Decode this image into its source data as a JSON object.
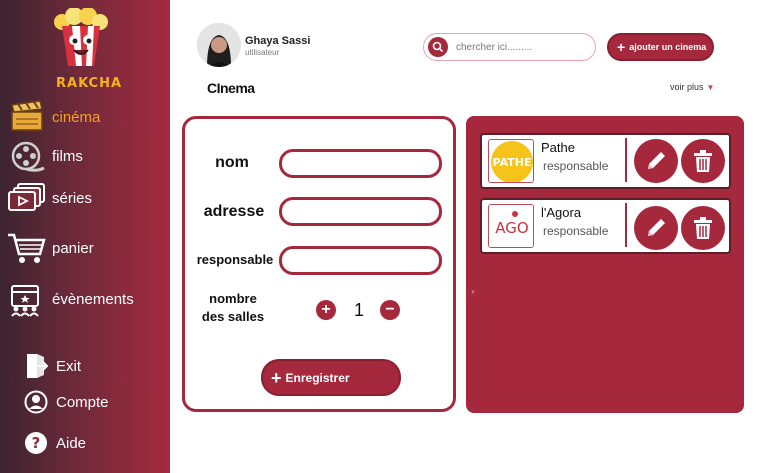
{
  "app": {
    "logo_text": "RAKCHA"
  },
  "sidebar": {
    "items": [
      {
        "label": "cinéma",
        "icon": "clapperboard-icon",
        "active": true
      },
      {
        "label": "films",
        "icon": "film-reel-icon",
        "active": false
      },
      {
        "label": "séries",
        "icon": "series-stack-icon",
        "active": false
      },
      {
        "label": "panier",
        "icon": "cart-icon",
        "active": false
      },
      {
        "label": "évènements",
        "icon": "calendar-people-icon",
        "active": false
      }
    ],
    "utility": [
      {
        "label": "Exit",
        "icon": "exit-door-icon"
      },
      {
        "label": "Compte",
        "icon": "user-circle-icon"
      },
      {
        "label": "Aide",
        "icon": "help-circle-icon"
      }
    ],
    "colors": {
      "active_label": "#f6a21b",
      "bg_end": "#a52a40"
    }
  },
  "header": {
    "user_name": "Ghaya Sassi",
    "user_role": "utilisateur",
    "search_placeholder": "chercher ici.........",
    "add_button_label": "ajouter un cinema",
    "page_title": "CInema",
    "voir_plus": "voir plus"
  },
  "form": {
    "labels": {
      "nom": "nom",
      "adresse": "adresse",
      "responsable": "responsable",
      "salles_line1": "nombre",
      "salles_line2": "des salles"
    },
    "values": {
      "nom": "",
      "adresse": "",
      "responsable": ""
    },
    "salles_count": "1",
    "save_label": "Enregistrer"
  },
  "cinemas": [
    {
      "name": "Pathe",
      "responsable": "responsable",
      "logo_text": "PATHE"
    },
    {
      "name": "l'Agora",
      "responsable": "responsable",
      "logo_text": "AGO"
    }
  ],
  "colors": {
    "accent": "#a5283d",
    "logo_yellow": "#f6b21b"
  }
}
